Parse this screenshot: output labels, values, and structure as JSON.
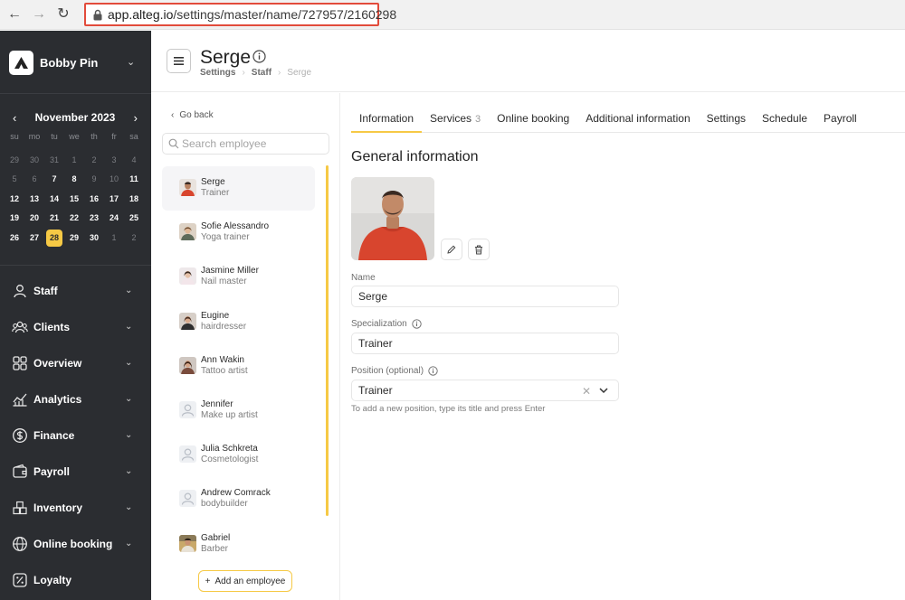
{
  "browser": {
    "url_host": "app.alteg.io",
    "url_path": "/settings/master/name/727957/2160298"
  },
  "brand": {
    "name": "Bobby Pin"
  },
  "calendar": {
    "month_label": "November 2023",
    "weekdays": [
      "su",
      "mo",
      "tu",
      "we",
      "th",
      "fr",
      "sa"
    ],
    "days": [
      {
        "d": "29",
        "muted": true
      },
      {
        "d": "30",
        "muted": true
      },
      {
        "d": "31",
        "muted": true
      },
      {
        "d": "1",
        "muted": true
      },
      {
        "d": "2",
        "muted": true
      },
      {
        "d": "3",
        "muted": true
      },
      {
        "d": "4",
        "muted": true
      },
      {
        "d": "5",
        "muted": true
      },
      {
        "d": "6",
        "muted": true
      },
      {
        "d": "7"
      },
      {
        "d": "8"
      },
      {
        "d": "9",
        "muted": true
      },
      {
        "d": "10",
        "muted": true
      },
      {
        "d": "11"
      },
      {
        "d": "12"
      },
      {
        "d": "13"
      },
      {
        "d": "14"
      },
      {
        "d": "15"
      },
      {
        "d": "16"
      },
      {
        "d": "17"
      },
      {
        "d": "18"
      },
      {
        "d": "19"
      },
      {
        "d": "20"
      },
      {
        "d": "21"
      },
      {
        "d": "22"
      },
      {
        "d": "23"
      },
      {
        "d": "24"
      },
      {
        "d": "25"
      },
      {
        "d": "26"
      },
      {
        "d": "27"
      },
      {
        "d": "28",
        "today": true
      },
      {
        "d": "29"
      },
      {
        "d": "30"
      },
      {
        "d": "1",
        "muted": true
      },
      {
        "d": "2",
        "muted": true
      }
    ]
  },
  "menu": [
    {
      "label": "Staff",
      "icon": "person-icon"
    },
    {
      "label": "Clients",
      "icon": "people-icon"
    },
    {
      "label": "Overview",
      "icon": "grid-icon"
    },
    {
      "label": "Analytics",
      "icon": "analytics-icon"
    },
    {
      "label": "Finance",
      "icon": "dollar-icon"
    },
    {
      "label": "Payroll",
      "icon": "wallet-icon"
    },
    {
      "label": "Inventory",
      "icon": "boxes-icon"
    },
    {
      "label": "Online booking",
      "icon": "globe-icon"
    },
    {
      "label": "Loyalty",
      "icon": "percent-icon"
    }
  ],
  "header": {
    "title": "Serge",
    "breadcrumb": [
      "Settings",
      "Staff",
      "Serge"
    ]
  },
  "employees_panel": {
    "go_back": "Go back",
    "search_placeholder": "Search employee",
    "add_label": "Add an employee",
    "items": [
      {
        "name": "Serge",
        "role": "Trainer",
        "active": true,
        "avatar": "photo"
      },
      {
        "name": "Sofie Alessandro",
        "role": "Yoga trainer",
        "avatar": "photo"
      },
      {
        "name": "Jasmine Miller",
        "role": "Nail master",
        "avatar": "photo"
      },
      {
        "name": "Eugine",
        "role": "hairdresser",
        "avatar": "photo"
      },
      {
        "name": "Ann Wakin",
        "role": "Tattoo artist",
        "avatar": "photo"
      },
      {
        "name": "Jennifer",
        "role": "Make up artist",
        "avatar": "placeholder"
      },
      {
        "name": "Julia Schkreta",
        "role": "Cosmetologist",
        "avatar": "placeholder"
      },
      {
        "name": "Andrew Comrack",
        "role": "bodybuilder",
        "avatar": "placeholder"
      },
      {
        "name": "Gabriel",
        "role": "Barber",
        "avatar": "photo"
      }
    ]
  },
  "tabs": [
    {
      "label": "Information",
      "active": true
    },
    {
      "label": "Services",
      "count": "3"
    },
    {
      "label": "Online booking"
    },
    {
      "label": "Additional information"
    },
    {
      "label": "Settings"
    },
    {
      "label": "Schedule"
    },
    {
      "label": "Payroll"
    }
  ],
  "form": {
    "section_title": "General information",
    "name_label": "Name",
    "name_value": "Serge",
    "specialization_label": "Specialization",
    "specialization_value": "Trainer",
    "position_label": "Position (optional)",
    "position_value": "Trainer",
    "position_hint": "To add a new position, type its title and press Enter"
  },
  "colors": {
    "sidebar_bg": "#2b2d31",
    "accent": "#f6c945",
    "url_highlight": "#e24b3b"
  }
}
